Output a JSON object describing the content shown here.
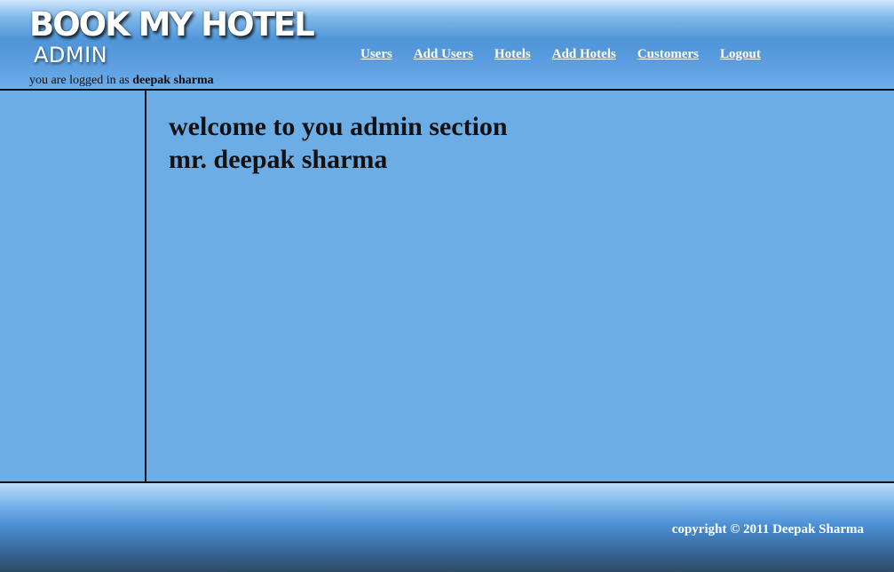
{
  "header": {
    "logo_title": "BOOK MY HOTEL",
    "logo_subtitle": "ADMIN",
    "logged_in_prefix": "you are logged in as",
    "logged_in_user": "deepak sharma",
    "nav": {
      "users": "Users",
      "add_users": "Add Users",
      "hotels": "Hotels",
      "add_hotels": "Add Hotels",
      "customers": "Customers",
      "logout": "Logout"
    }
  },
  "main": {
    "welcome_line1": "welcome to you admin section",
    "welcome_line2": "mr. deepak sharma"
  },
  "footer": {
    "copyright": "copyright © 2011 Deepak Sharma"
  },
  "colors": {
    "background": "#6dade6",
    "nav_link": "#ffffff",
    "border": "#111111"
  }
}
